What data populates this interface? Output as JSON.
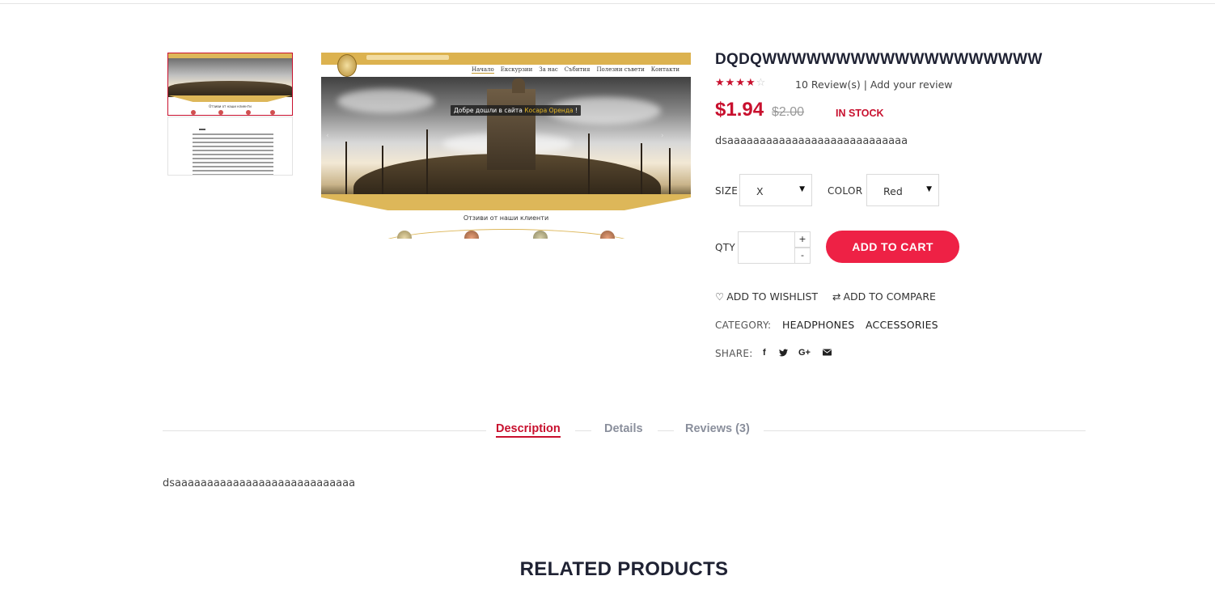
{
  "gallery": {
    "main_banner_prefix": "Добре дошли в сайта ",
    "main_banner_accent": "Косара Оренда",
    "main_banner_suffix": " !",
    "main_nav": [
      "Начало",
      "Екскурзии",
      "За нас",
      "Събития",
      "Полезни съвети",
      "Контакти"
    ],
    "main_testimonials": "Отзиви от наши клиенти",
    "thumb_testimonials": "Отзиви от наши клиенти"
  },
  "product": {
    "title": "DQDQWWWWWWWWWWWWWWWWWWW",
    "rating": 4,
    "rating_max": 5,
    "reviews_text": "10 Review(s) | Add your review",
    "price": "$1.94",
    "old_price": "$2.00",
    "stock": "IN STOCK",
    "short_description": "dsaaaaaaaaaaaaaaaaaaaaaaaaaaaa",
    "size_label": "SIZE",
    "size_value": "X",
    "color_label": "COLOR",
    "color_value": "Red",
    "qty_label": "QTY",
    "qty_value": "",
    "qty_plus": "+",
    "qty_minus": "-",
    "add_to_cart": "ADD TO CART",
    "wishlist": "ADD TO WISHLIST",
    "compare": "ADD TO COMPARE",
    "category_label": "CATEGORY:",
    "categories": [
      "HEADPHONES",
      "ACCESSORIES"
    ],
    "share_label": "SHARE:"
  },
  "tabs": {
    "description": "Description",
    "details": "Details",
    "reviews": "Reviews (3)",
    "active": "description",
    "content": "dsaaaaaaaaaaaaaaaaaaaaaaaaaaaa"
  },
  "related": {
    "title": "RELATED PRODUCTS"
  },
  "colors": {
    "accent": "#c8102e",
    "button": "#ee2145",
    "gold": "#ddb759"
  },
  "icons": {
    "wishlist": "heart-icon",
    "compare": "compare-arrows-icon",
    "share": [
      "facebook-icon",
      "twitter-icon",
      "google-plus-icon",
      "email-icon"
    ],
    "select": "caret-down-icon"
  }
}
